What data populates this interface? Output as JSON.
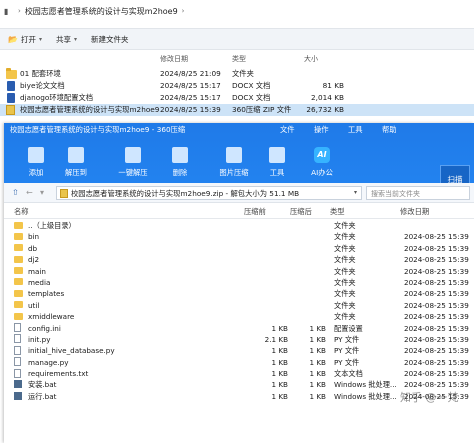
{
  "explorer": {
    "breadcrumb": "校园志愿者管理系统的设计与实现m2hoe9",
    "toolbar": {
      "open": "打开",
      "share": "共享",
      "new_folder": "新建文件夹"
    },
    "columns": {
      "modified": "修改日期",
      "type": "类型",
      "size": "大小"
    },
    "files": [
      {
        "name": "01 配套环境",
        "date": "2024/8/25 21:09",
        "type": "文件夹",
        "size": "",
        "icon": "folder-icon"
      },
      {
        "name": "biye论文文档",
        "date": "2024/8/25 15:17",
        "type": "DOCX 文档",
        "size": "81 KB",
        "icon": "docx-icon"
      },
      {
        "name": "djanogo环境配置文档",
        "date": "2024/8/25 15:17",
        "type": "DOCX 文档",
        "size": "2,014 KB",
        "icon": "docx-icon"
      },
      {
        "name": "校园志愿者管理系统的设计与实现m2hoe9",
        "date": "2024/8/25 15:39",
        "type": "360压缩 ZIP 文件",
        "size": "26,732 KB",
        "icon": "zip-icon"
      }
    ]
  },
  "zip_window": {
    "title": "校园志愿者管理系统的设计与实现m2hoe9 - 360压缩",
    "menu": [
      "文件",
      "操作",
      "工具",
      "帮助"
    ],
    "tools": [
      {
        "label": "添加",
        "icon": "add-icon"
      },
      {
        "label": "解压到",
        "icon": "extract-to-icon"
      },
      {
        "label": "一键解压",
        "icon": "one-click-extract-icon"
      },
      {
        "label": "删除",
        "icon": "delete-icon"
      },
      {
        "label": "图片压缩",
        "icon": "image-compress-icon"
      },
      {
        "label": "工具",
        "icon": "tools-icon"
      },
      {
        "label": "AI办公",
        "icon": "ai-office-icon"
      }
    ],
    "ai_badge": "AI",
    "scan_button": "扫描",
    "path": "校园志愿者管理系统的设计与实现m2hoe9.zip - 解包大小为 51.1 MB",
    "search_placeholder": "搜索当前文件夹",
    "columns": {
      "name": "名称",
      "compressed": "压缩前",
      "after": "压缩后",
      "type": "类型",
      "modified": "修改日期"
    },
    "rows": [
      {
        "name": "..（上级目录）",
        "before": "",
        "after": "",
        "type": "文件夹",
        "date": "",
        "icon": "folder-icon"
      },
      {
        "name": "bin",
        "before": "",
        "after": "",
        "type": "文件夹",
        "date": "2024-08-25 15:39",
        "icon": "folder-icon"
      },
      {
        "name": "db",
        "before": "",
        "after": "",
        "type": "文件夹",
        "date": "2024-08-25 15:39",
        "icon": "folder-icon"
      },
      {
        "name": "dj2",
        "before": "",
        "after": "",
        "type": "文件夹",
        "date": "2024-08-25 15:39",
        "icon": "folder-icon"
      },
      {
        "name": "main",
        "before": "",
        "after": "",
        "type": "文件夹",
        "date": "2024-08-25 15:39",
        "icon": "folder-icon"
      },
      {
        "name": "media",
        "before": "",
        "after": "",
        "type": "文件夹",
        "date": "2024-08-25 15:39",
        "icon": "folder-icon"
      },
      {
        "name": "templates",
        "before": "",
        "after": "",
        "type": "文件夹",
        "date": "2024-08-25 15:39",
        "icon": "folder-icon"
      },
      {
        "name": "util",
        "before": "",
        "after": "",
        "type": "文件夹",
        "date": "2024-08-25 15:39",
        "icon": "folder-icon"
      },
      {
        "name": "xmiddleware",
        "before": "",
        "after": "",
        "type": "文件夹",
        "date": "2024-08-25 15:39",
        "icon": "folder-icon"
      },
      {
        "name": "config.ini",
        "before": "1 KB",
        "after": "1 KB",
        "type": "配置设置",
        "date": "2024-08-25 15:39",
        "icon": "ini-icon"
      },
      {
        "name": "init.py",
        "before": "2.1 KB",
        "after": "1 KB",
        "type": "PY 文件",
        "date": "2024-08-25 15:39",
        "icon": "py-icon"
      },
      {
        "name": "initial_hive_database.py",
        "before": "1 KB",
        "after": "1 KB",
        "type": "PY 文件",
        "date": "2024-08-25 15:39",
        "icon": "py-icon"
      },
      {
        "name": "manage.py",
        "before": "1 KB",
        "after": "1 KB",
        "type": "PY 文件",
        "date": "2024-08-25 15:39",
        "icon": "py-icon"
      },
      {
        "name": "requirements.txt",
        "before": "1 KB",
        "after": "1 KB",
        "type": "文本文档",
        "date": "2024-08-25 15:39",
        "icon": "txt-icon"
      },
      {
        "name": "安装.bat",
        "before": "1 KB",
        "after": "1 KB",
        "type": "Windows 批处理...",
        "date": "2024-08-25 15:39",
        "icon": "bat-icon"
      },
      {
        "name": "运行.bat",
        "before": "1 KB",
        "after": "1 KB",
        "type": "Windows 批处理...",
        "date": "2024-08-25 15:39",
        "icon": "bat-icon"
      }
    ]
  },
  "watermark": "知乎 @一梵"
}
